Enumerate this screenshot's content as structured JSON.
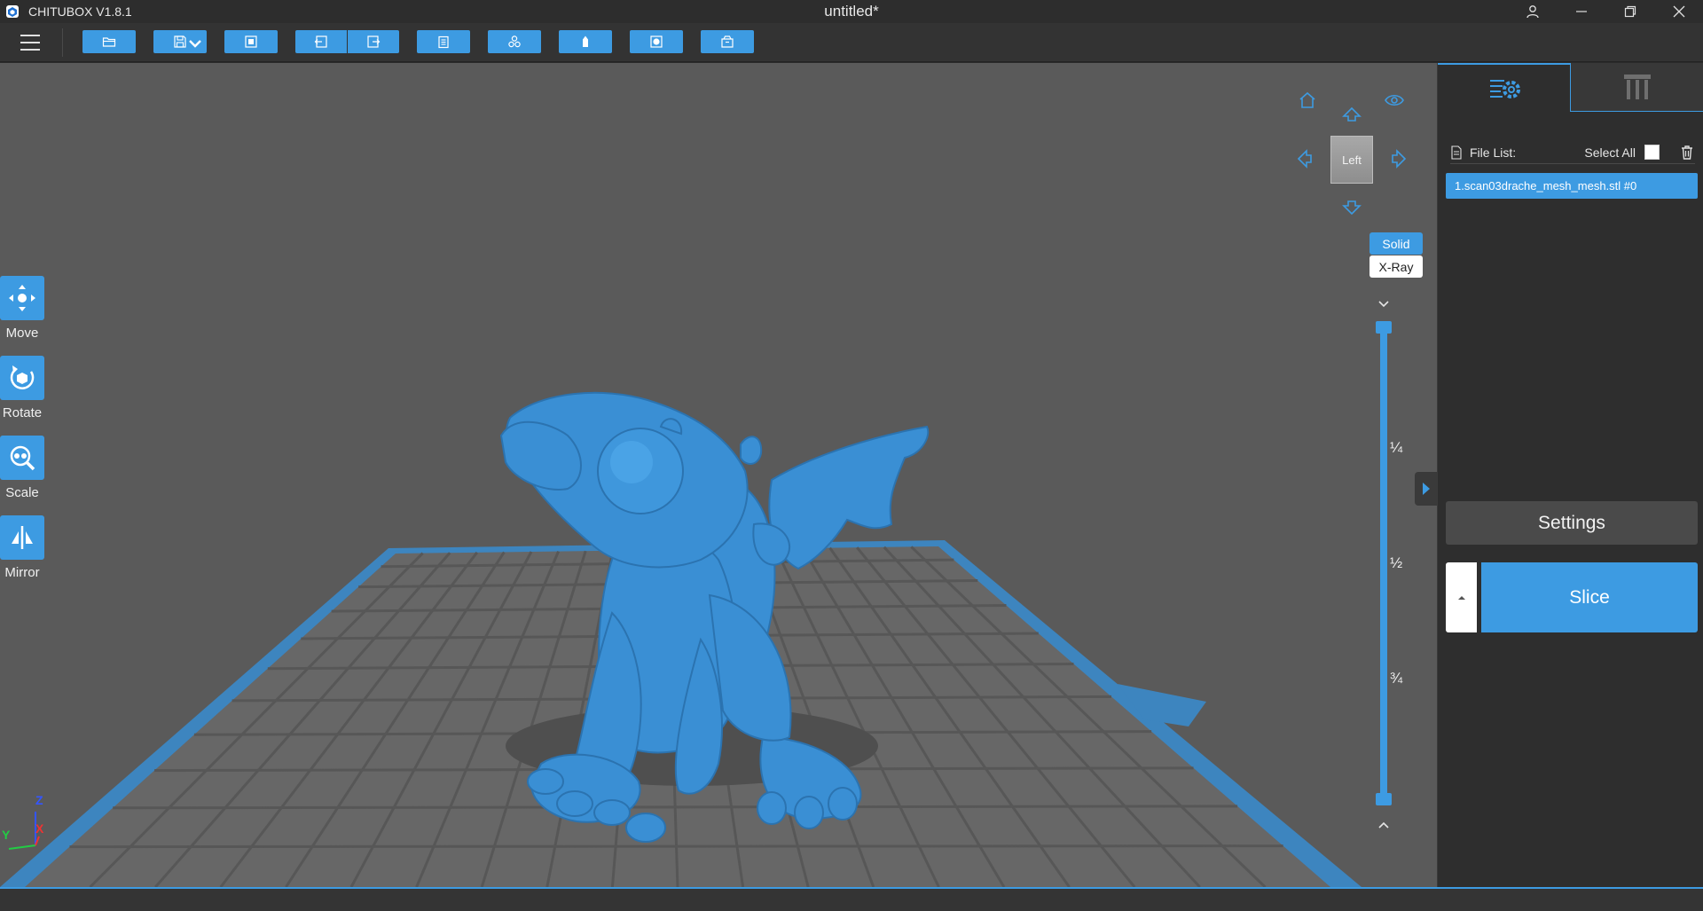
{
  "window": {
    "app_name": "CHITUBOX V1.8.1",
    "doc_title": "untitled*",
    "controls": [
      "user-icon",
      "minimize-icon",
      "restore-icon",
      "close-icon"
    ]
  },
  "toolbar": {
    "buttons": [
      "open-file-icon",
      "save-icon",
      "auto-layout-icon",
      "undo-icon",
      "redo-icon",
      "clipboard-icon",
      "duplicate-icon",
      "hollow-icon",
      "lamp-icon",
      "export-icon"
    ]
  },
  "tools": {
    "move": "Move",
    "rotate": "Rotate",
    "scale": "Scale",
    "mirror": "Mirror"
  },
  "view_cube": {
    "face": "Left"
  },
  "render_modes": {
    "solid": "Solid",
    "xray": "X-Ray",
    "active": "Solid"
  },
  "layer_slider": {
    "marks": [
      "¼",
      "½",
      "¾"
    ]
  },
  "axes": {
    "z": "Z",
    "y": "Y",
    "x": "X"
  },
  "panel": {
    "file_list_label": "File List:",
    "select_all_label": "Select All",
    "files": [
      "1.scan03drache_mesh_mesh.stl #0"
    ],
    "settings_label": "Settings",
    "slice_label": "Slice"
  },
  "colors": {
    "accent": "#3d9be2",
    "model": "#3a8fd4",
    "viewport_bg": "#5a5a5a"
  }
}
